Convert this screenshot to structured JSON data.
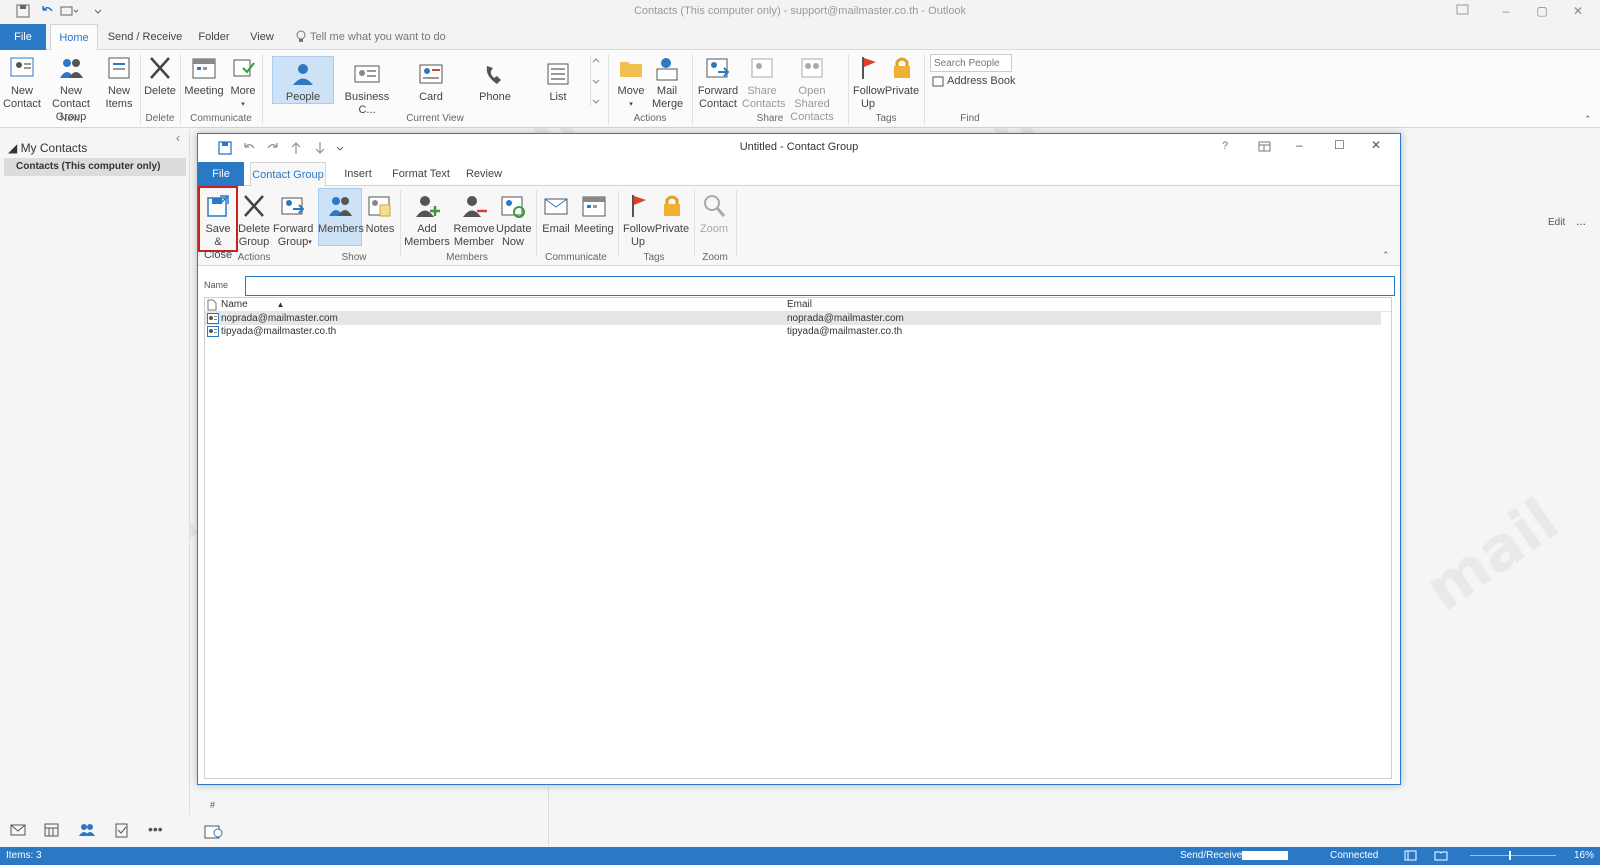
{
  "window": {
    "title": "Contacts (This computer only) - support@mailmaster.co.th  -  Outlook"
  },
  "main_tabs": [
    "File",
    "Home",
    "Send / Receive",
    "Folder",
    "View"
  ],
  "tell_me": "Tell me what you want to do",
  "ribbon": {
    "new_contact": "New Contact",
    "new_contact_group": "New Contact Group",
    "new_items": "New Items",
    "delete": "Delete",
    "meeting": "Meeting",
    "more": "More",
    "views": [
      "People",
      "Business C...",
      "Card",
      "Phone",
      "List"
    ],
    "move": "Move",
    "mail_merge": "Mail Merge",
    "forward_contact": "Forward Contact",
    "share_contacts": "Share Contacts",
    "open_shared_contacts": "Open Shared Contacts",
    "follow_up": "Follow Up",
    "private": "Private",
    "search_people_placeholder": "Search People",
    "address_book": "Address Book",
    "groups": {
      "new": "New",
      "delete": "Delete",
      "communicate": "Communicate",
      "current_view": "Current View",
      "actions": "Actions",
      "share": "Share",
      "tags": "Tags",
      "find": "Find"
    }
  },
  "nav": {
    "my_contacts": "My Contacts",
    "contacts_folder": "Contacts (This computer only)"
  },
  "right_pane": {
    "edit": "Edit",
    "more": "..."
  },
  "cg": {
    "title": "Untitled  -  Contact Group",
    "help": "?",
    "tabs": [
      "File",
      "Contact Group",
      "Insert",
      "Format Text",
      "Review"
    ],
    "buttons": {
      "save_close": "Save & Close",
      "delete_group": "Delete Group",
      "forward_group": "Forward Group",
      "members": "Members",
      "notes": "Notes",
      "add_members": "Add Members",
      "remove_member": "Remove Member",
      "update_now": "Update Now",
      "email": "Email",
      "meeting": "Meeting",
      "follow_up": "Follow Up",
      "private": "Private",
      "zoom": "Zoom"
    },
    "groups": {
      "actions": "Actions",
      "show": "Show",
      "members": "Members",
      "communicate": "Communicate",
      "tags": "Tags",
      "zoom": "Zoom"
    },
    "name_label": "Name",
    "name_value": "",
    "columns": [
      "Name",
      "Email"
    ],
    "members": [
      {
        "name": "noprada@mailmaster.com",
        "email": "noprada@mailmaster.com"
      },
      {
        "name": "tipyada@mailmaster.co.th",
        "email": "tipyada@mailmaster.co.th"
      }
    ]
  },
  "index_letters": [
    "#"
  ],
  "status": {
    "items": "Items: 3",
    "send_receive": "Send/Receive",
    "connected": "Connected",
    "zoom": "16%"
  },
  "colors": {
    "accent": "#2b78c4",
    "highlight": "#cc1f1f"
  }
}
